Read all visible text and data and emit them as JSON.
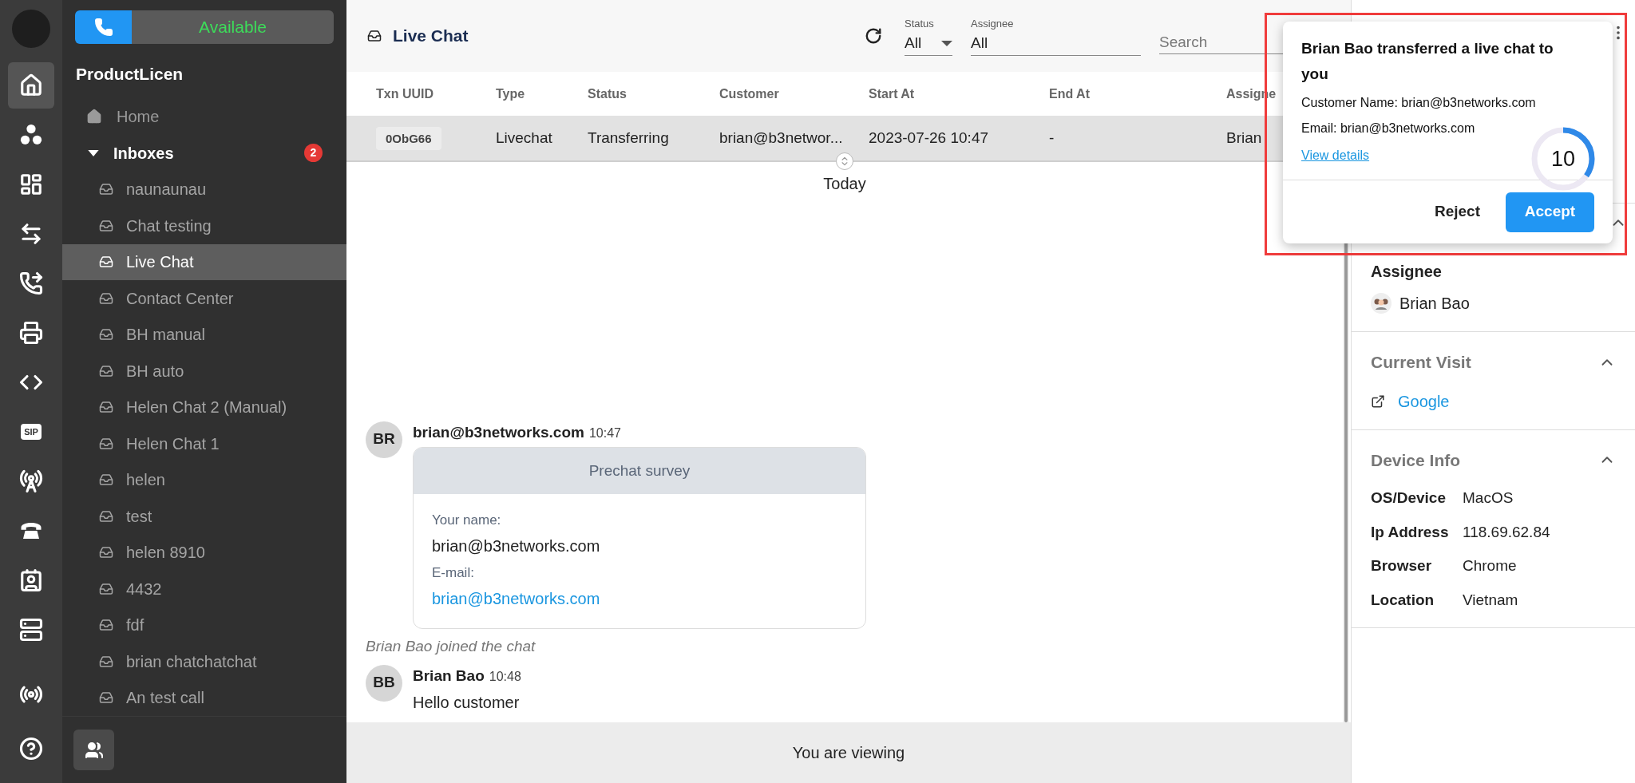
{
  "rail": {
    "items": [
      {
        "selected": true
      },
      {
        "selected": false
      },
      {
        "selected": false
      },
      {
        "selected": false
      },
      {
        "selected": false
      },
      {
        "selected": false
      },
      {
        "selected": false
      },
      {
        "selected": false,
        "text": "SIP"
      },
      {
        "selected": false
      },
      {
        "selected": false
      },
      {
        "selected": false
      },
      {
        "selected": false
      }
    ],
    "bottom_items": [
      {
        "selected": false
      },
      {
        "selected": false
      }
    ]
  },
  "agent_status": {
    "label": "Available"
  },
  "sidebar": {
    "title": "ProductLicen",
    "home": "Home",
    "inboxes": {
      "label": "Inboxes",
      "badge": "2",
      "expanded": true,
      "items": [
        {
          "label": "naunaunau",
          "selected": false
        },
        {
          "label": "Chat testing",
          "selected": false
        },
        {
          "label": "Live Chat",
          "selected": true
        },
        {
          "label": "Contact Center",
          "selected": false
        },
        {
          "label": "BH manual",
          "selected": false
        },
        {
          "label": "BH auto",
          "selected": false
        },
        {
          "label": "Helen Chat 2 (Manual)",
          "selected": false
        },
        {
          "label": "Helen Chat 1",
          "selected": false
        },
        {
          "label": "helen",
          "selected": false
        },
        {
          "label": "test",
          "selected": false
        },
        {
          "label": "helen 8910",
          "selected": false
        },
        {
          "label": "4432",
          "selected": false
        },
        {
          "label": "fdf",
          "selected": false
        },
        {
          "label": "brian chatchatchat",
          "selected": false
        },
        {
          "label": "An test call",
          "selected": false
        }
      ]
    }
  },
  "header": {
    "title": "Live Chat",
    "status": {
      "label": "Status",
      "value": "All"
    },
    "assignee": {
      "label": "Assignee",
      "value": "All"
    },
    "search": {
      "placeholder": "Search"
    }
  },
  "table": {
    "columns": [
      "Txn UUID",
      "Type",
      "Status",
      "Customer",
      "Start At",
      "End At",
      "Assigne"
    ],
    "rows": [
      {
        "selected": true,
        "cells": [
          "0ObG66",
          "Livechat",
          "Transferring",
          "brian@b3networ...",
          "2023-07-26 10:47",
          "-",
          "Brian"
        ]
      }
    ]
  },
  "chat": {
    "date": "Today",
    "messages": [
      {
        "kind": "survey",
        "initials": "BR",
        "sender": "brian@b3networks.com",
        "time": "10:47",
        "title": "Prechat survey",
        "fields": [
          {
            "label": "Your name:",
            "value": "brian@b3networks.com",
            "link": false
          },
          {
            "label": "E-mail:",
            "value": "brian@b3networks.com",
            "link": true
          }
        ]
      },
      {
        "kind": "system",
        "text": "Brian Bao joined the chat"
      },
      {
        "kind": "text",
        "initials": "BB",
        "sender": "Brian Bao",
        "time": "10:48",
        "text": "Hello customer"
      }
    ],
    "footer": "You are viewing"
  },
  "details": {
    "assignee": {
      "label": "Assignee",
      "name": "Brian Bao"
    },
    "current_visit": {
      "title": "Current Visit",
      "expanded": true,
      "link": "Google"
    },
    "device_info": {
      "title": "Device Info",
      "expanded": true,
      "rows": [
        {
          "label": "OS/Device",
          "value": "MacOS"
        },
        {
          "label": "Ip Address",
          "value": "118.69.62.84"
        },
        {
          "label": "Browser",
          "value": "Chrome"
        },
        {
          "label": "Location",
          "value": "Vietnam"
        }
      ]
    }
  },
  "notification": {
    "title": "Brian Bao transferred a live chat to you",
    "lines": [
      "Customer Name: brian@b3networks.com",
      "Email: brian@b3networks.com"
    ],
    "link": "View details",
    "countdown": {
      "value": "10",
      "level": 0.35
    },
    "buttons": [
      {
        "label": "Reject",
        "kind": "text"
      },
      {
        "label": "Accept",
        "kind": "primary"
      }
    ]
  }
}
